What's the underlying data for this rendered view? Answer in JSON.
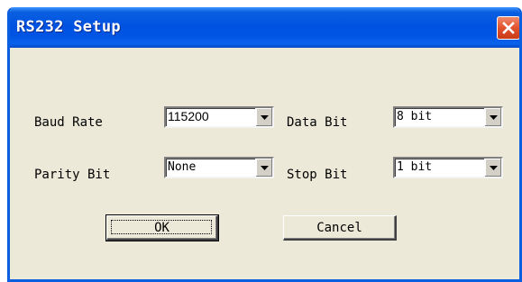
{
  "window": {
    "title": "RS232 Setup",
    "close_icon": "close-icon"
  },
  "fields": {
    "baud_rate": {
      "label": "Baud Rate",
      "value": "115200"
    },
    "data_bit": {
      "label": "Data Bit",
      "value": "8 bit"
    },
    "parity_bit": {
      "label": "Parity Bit",
      "value": "None"
    },
    "stop_bit": {
      "label": "Stop Bit",
      "value": "1 bit"
    }
  },
  "buttons": {
    "ok_label": "OK",
    "cancel_label": "Cancel"
  },
  "icons": {
    "dropdown": "chevron-down-icon"
  },
  "colors": {
    "titlebar": "#0054e3",
    "close_button": "#e2512d",
    "dialog_background": "#ece9d8"
  }
}
